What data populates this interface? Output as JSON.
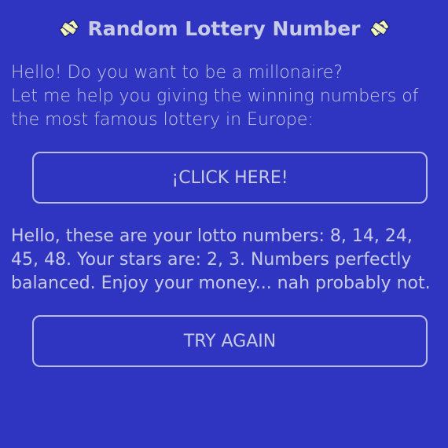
{
  "header": {
    "title": "Random Lottery Number",
    "left_icon": "ticket-icon",
    "right_icon": "ticket-icon"
  },
  "intro": {
    "line1": "Hello! Do you want to be a millonaire?",
    "line2": "Let me help you giving the winning numbers of the most famous lottery in Europe:"
  },
  "buttons": {
    "click_label": "¡CLICK HERE!",
    "try_again_label": "TRY AGAIN"
  },
  "result": {
    "text": "Hello, these are your lotto numbers: 8, 14, 24, 45, 48. Your stars are: 2, 3. Numbers perfectly balanced. Enjoy your money... nah probably not."
  },
  "colors": {
    "background": "#2f35c0",
    "text": "#c8cbe6",
    "button_border": "#b8bde8",
    "icon_fill": "#f3f7b8"
  }
}
